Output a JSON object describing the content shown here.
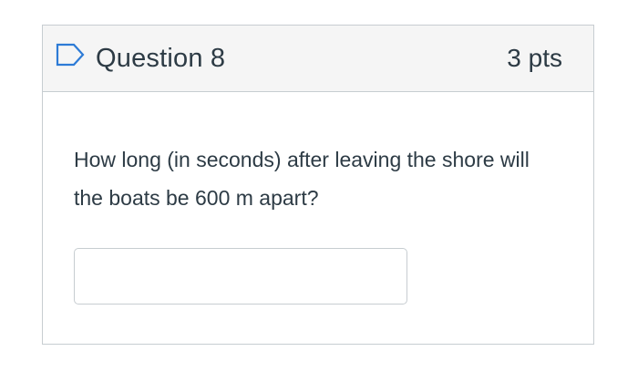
{
  "question": {
    "title": "Question 8",
    "points": "3 pts",
    "text": "How long (in seconds) after leaving the shore will the boats be 600 m apart?",
    "answer_value": "",
    "flag_icon": "flag-outline-icon"
  },
  "colors": {
    "text": "#2d3b45",
    "header_bg": "#f5f5f5",
    "border": "#c7cdd1",
    "flag_stroke": "#2d7bd6"
  }
}
